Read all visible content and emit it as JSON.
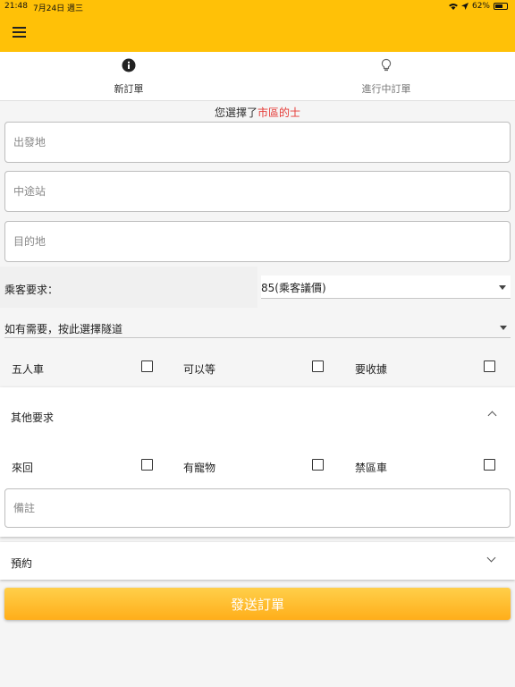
{
  "status_bar": {
    "time": "21:48",
    "date": "7月24日 週三",
    "battery": "62%"
  },
  "colors": {
    "primary": "#ffc107",
    "tab_indicator": "#4a90d9",
    "highlight": "#e53935"
  },
  "app_bar": {
    "menu_icon": "hamburger-menu-icon"
  },
  "tabs": [
    {
      "label": "新訂單",
      "icon": "info-icon",
      "active": true
    },
    {
      "label": "進行中訂單",
      "icon": "lightbulb-icon",
      "active": false
    }
  ],
  "selection": {
    "prefix": "您選擇了",
    "value": "市區的士"
  },
  "fields": {
    "departure_placeholder": "出發地",
    "stopover_placeholder": "中途站",
    "destination_placeholder": "目的地"
  },
  "passenger_request": {
    "label": "乘客要求：",
    "selected": "85(乘客議價)"
  },
  "tunnel": {
    "label": "如有需要，按此選擇隧道"
  },
  "options_top": [
    {
      "label": "五人車",
      "checked": false
    },
    {
      "label": "可以等",
      "checked": false
    },
    {
      "label": "要收據",
      "checked": false
    }
  ],
  "other_requests": {
    "title": "其他要求",
    "options": [
      {
        "label": "來回",
        "checked": false
      },
      {
        "label": "有寵物",
        "checked": false
      },
      {
        "label": "禁區車",
        "checked": false
      }
    ],
    "note_placeholder": "備註"
  },
  "booking": {
    "label": "預約"
  },
  "submit": {
    "label": "發送訂單"
  }
}
